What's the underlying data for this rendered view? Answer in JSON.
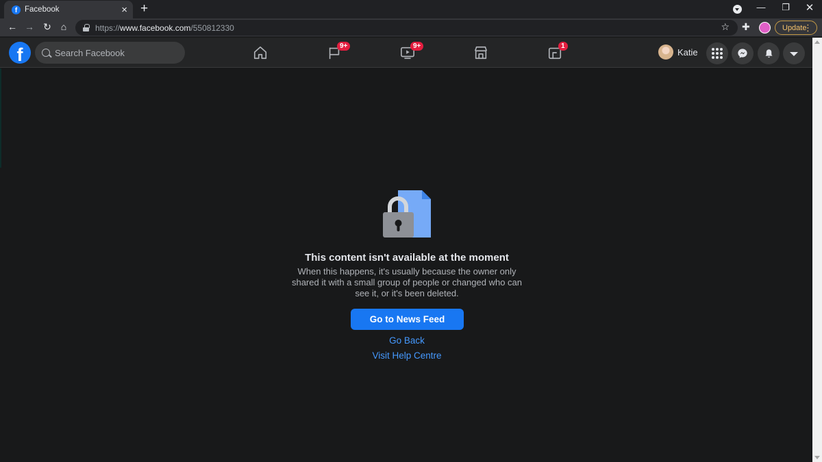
{
  "browser": {
    "tab_title": "Facebook",
    "tab_favicon_letter": "f",
    "tab_close_icon": "×",
    "new_tab_icon": "+",
    "url_scheme": "https://",
    "url_host": "www.facebook.com",
    "url_path": "/550812330",
    "update_label": "Update"
  },
  "header": {
    "logo_letter": "f",
    "search_placeholder": "Search Facebook",
    "user_name": "Katie",
    "badges": {
      "pages": "9+",
      "watch": "9+",
      "gaming": "1"
    }
  },
  "main": {
    "title": "This content isn't available at the moment",
    "body": "When this happens, it's usually because the owner only shared it with a small group of people or changed who can see it, or it's been deleted.",
    "primary_button": "Go to News Feed",
    "go_back": "Go Back",
    "help": "Visit Help Centre"
  },
  "colors": {
    "brand_blue": "#1877f2",
    "link_blue": "#4599ff",
    "badge_red": "#e41e3f",
    "page_bg": "#18191a",
    "header_bg": "#242526"
  }
}
